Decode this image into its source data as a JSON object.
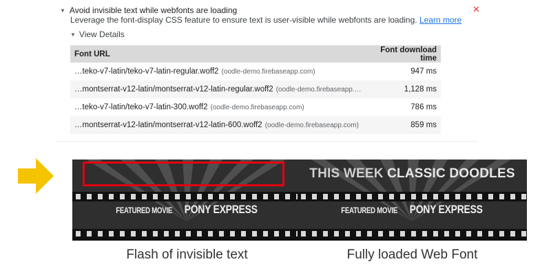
{
  "audit": {
    "title": "Avoid invisible text while webfonts are loading",
    "description": "Leverage the font-display CSS feature to ensure text is user-visible while webfonts are loading.",
    "learn_more": "Learn more",
    "status_icon": "fail-x-icon",
    "details_toggle": "View Details",
    "status_color": "#e53935"
  },
  "table": {
    "headers": [
      "Font URL",
      "Font download time"
    ],
    "rows": [
      {
        "url": "…teko-v7-latin/teko-v7-latin-regular.woff2",
        "host": "(oodle-demo.firebaseapp.com)",
        "time": "947 ms"
      },
      {
        "url": "…montserrat-v12-latin/montserrat-v12-latin-regular.woff2",
        "host": "(oodle-demo.firebaseapp.…",
        "time": "1,128 ms"
      },
      {
        "url": "…teko-v7-latin/teko-v7-latin-300.woff2",
        "host": "(oodle-demo.firebaseapp.com)",
        "time": "786 ms"
      },
      {
        "url": "…montserrat-v12-latin/montserrat-v12-latin-600.woff2",
        "host": "(oodle-demo.firebaseapp.com)",
        "time": "859 ms"
      }
    ]
  },
  "pointer": {
    "icon": "arrow-right-icon",
    "color": "#f5c400"
  },
  "banners": {
    "left": {
      "featured_small": "FEATURED MOVIE",
      "featured_big": "PONY EXPRESS",
      "caption": "Flash of invisible text",
      "highlight_color": "#e3000f"
    },
    "right": {
      "headline_a": "THIS WEEK",
      "headline_b": "CLASSIC DOODLES",
      "featured_small": "FEATURED MOVIE",
      "featured_big": "PONY EXPRESS",
      "caption": "Fully loaded Web Font"
    }
  }
}
